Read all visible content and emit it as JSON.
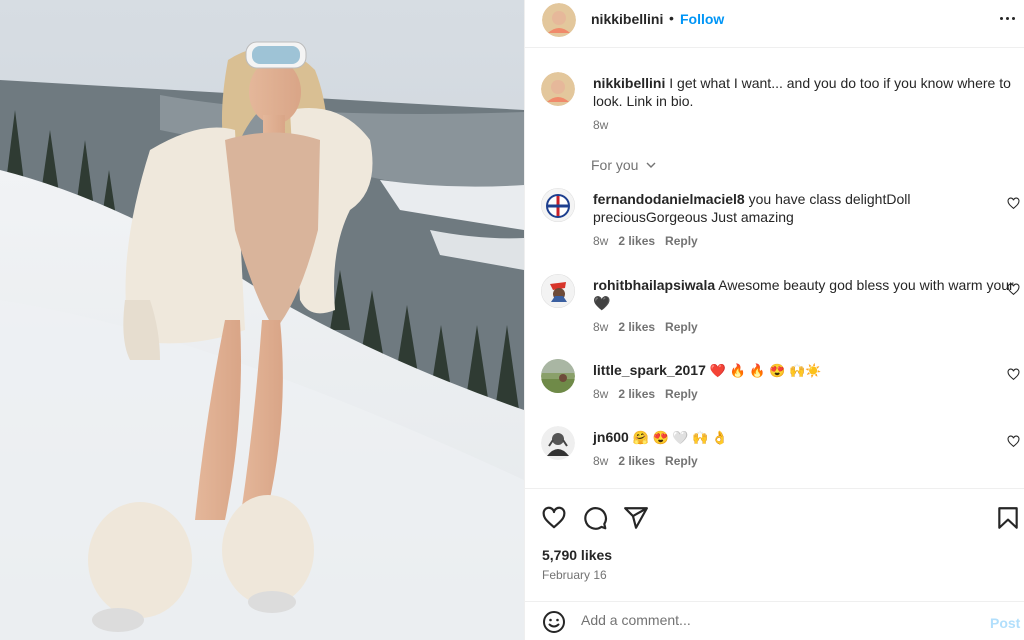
{
  "post": {
    "image_alt": "woman in snow wearing ski goggles and jacket"
  },
  "header": {
    "username": "nikkibellini",
    "separator": "•",
    "follow_label": "Follow",
    "more_icon": "more-horizontal-icon"
  },
  "caption": {
    "username": "nikkibellini",
    "text": "I get what I want... and you do too if you know where to look. Link in bio.",
    "time": "8w"
  },
  "for_you_label": "For you",
  "comments": [
    {
      "username": "fernandodanielmaciel8",
      "text": "you have class delightDoll preciousGorgeous Just amazing",
      "time": "8w",
      "likes": "2 likes",
      "reply": "Reply"
    },
    {
      "username": "rohitbhailapsiwala",
      "text": "Awesome beauty god bless you with warm your 🖤",
      "time": "8w",
      "likes": "2 likes",
      "reply": "Reply"
    },
    {
      "username": "little_spark_2017",
      "text": "❤️ 🔥 🔥 😍 🙌☀️",
      "time": "8w",
      "likes": "2 likes",
      "reply": "Reply"
    },
    {
      "username": "jn600",
      "text": "🤗 😍 🤍 🙌 👌",
      "time": "8w",
      "likes": "2 likes",
      "reply": "Reply"
    }
  ],
  "actions": {
    "likes_label": "5,790 likes",
    "date": "February 16"
  },
  "add_comment": {
    "placeholder": "Add a comment...",
    "post_label": "Post"
  },
  "colors": {
    "accent": "#0095f6",
    "muted": "#737373",
    "post_disabled": "#b2dffc"
  }
}
